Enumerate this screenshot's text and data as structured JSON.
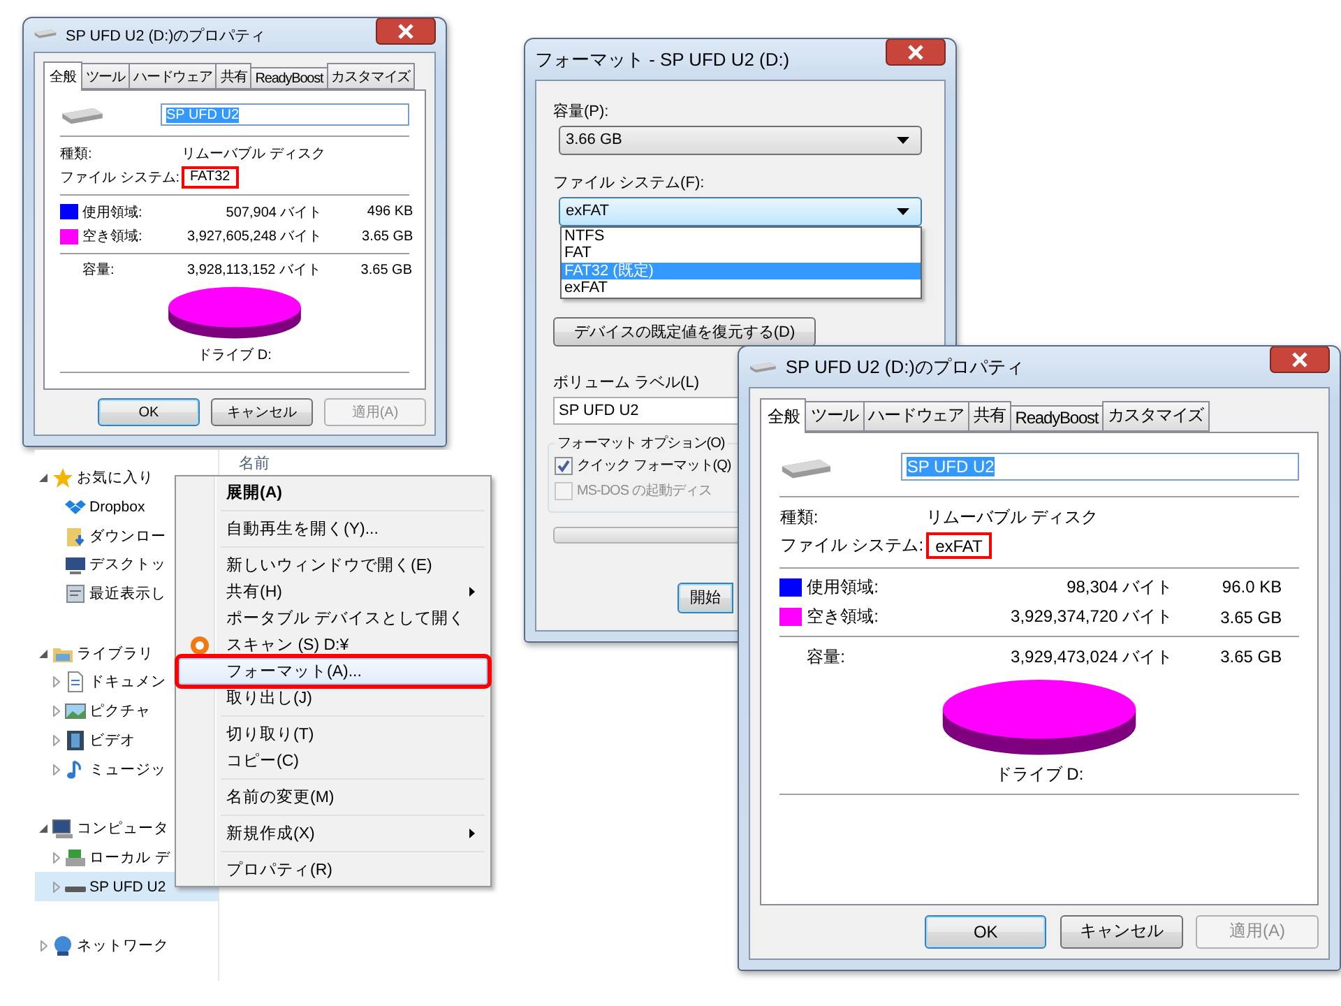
{
  "property_windows": [
    {
      "title": "SP UFD U2 (D:)のプロパティ",
      "tabs": [
        {
          "label": "全般",
          "selected": true
        },
        {
          "label": "ツール",
          "selected": false
        },
        {
          "label": "ハードウェア",
          "selected": false
        },
        {
          "label": "共有",
          "selected": false
        },
        {
          "label": "ReadyBoost",
          "selected": false
        },
        {
          "label": "カスタマイズ",
          "selected": false
        }
      ],
      "name": "SP UFD U2",
      "name_selected": true,
      "type_label": "種類:",
      "type_value": "リムーバブル ディスク",
      "fs_label": "ファイル システム:",
      "fs_value": "FAT32",
      "fs_highlighted": true,
      "usage": [
        {
          "label": "使用領域:",
          "color": "#0000ff",
          "bytes": "507,904 バイト",
          "size": "496 KB"
        },
        {
          "label": "空き領域:",
          "color": "#ff00ff",
          "bytes": "3,927,605,248 バイト",
          "size": "3.65 GB"
        }
      ],
      "capacity": {
        "label": "容量:",
        "bytes": "3,928,113,152 バイト",
        "size": "3.65 GB"
      },
      "drive_label": "ドライブ D:",
      "buttons": [
        {
          "label": "OK",
          "default": true,
          "disabled": false
        },
        {
          "label": "キャンセル",
          "default": false,
          "disabled": false
        },
        {
          "label": "適用(A)",
          "default": false,
          "disabled": true
        }
      ]
    },
    {
      "title": "SP UFD U2 (D:)のプロパティ",
      "tabs": [
        {
          "label": "全般",
          "selected": true
        },
        {
          "label": "ツール",
          "selected": false
        },
        {
          "label": "ハードウェア",
          "selected": false
        },
        {
          "label": "共有",
          "selected": false
        },
        {
          "label": "ReadyBoost",
          "selected": false
        },
        {
          "label": "カスタマイズ",
          "selected": false
        }
      ],
      "name": "SP UFD U2",
      "name_selected": true,
      "type_label": "種類:",
      "type_value": "リムーバブル ディスク",
      "fs_label": "ファイル システム:",
      "fs_value": "exFAT",
      "fs_highlighted": true,
      "usage": [
        {
          "label": "使用領域:",
          "color": "#0000ff",
          "bytes": "98,304 バイト",
          "size": "96.0 KB"
        },
        {
          "label": "空き領域:",
          "color": "#ff00ff",
          "bytes": "3,929,374,720 バイト",
          "size": "3.65 GB"
        }
      ],
      "capacity": {
        "label": "容量:",
        "bytes": "3,929,473,024 バイト",
        "size": "3.65 GB"
      },
      "drive_label": "ドライブ D:",
      "buttons": [
        {
          "label": "OK",
          "default": true,
          "disabled": false
        },
        {
          "label": "キャンセル",
          "default": false,
          "disabled": false
        },
        {
          "label": "適用(A)",
          "default": false,
          "disabled": true
        }
      ]
    }
  ],
  "explorer": {
    "column_header": "名前",
    "tree": [
      {
        "label": "お気に入り",
        "kind": "star",
        "expanded": true,
        "selected": false,
        "children": [
          {
            "label": "Dropbox",
            "kind": "dropbox",
            "selected": false
          },
          {
            "label": "ダウンロー",
            "kind": "download",
            "selected": false
          },
          {
            "label": "デスクトッ",
            "kind": "desktop",
            "selected": false
          },
          {
            "label": "最近表示し",
            "kind": "recent",
            "selected": false
          }
        ]
      },
      {
        "label": "ライブラリ",
        "kind": "library",
        "expanded": true,
        "selected": false,
        "children": [
          {
            "label": "ドキュメン",
            "kind": "document",
            "expanded": false,
            "selected": false
          },
          {
            "label": "ピクチャ",
            "kind": "picture",
            "expanded": false,
            "selected": false
          },
          {
            "label": "ビデオ",
            "kind": "video",
            "expanded": false,
            "selected": false
          },
          {
            "label": "ミュージッ",
            "kind": "music",
            "expanded": false,
            "selected": false
          }
        ]
      },
      {
        "label": "コンピュータ",
        "kind": "computer",
        "expanded": true,
        "selected": false,
        "children": [
          {
            "label": "ローカル デ",
            "kind": "disk",
            "expanded": false,
            "selected": false
          },
          {
            "label": "SP UFD U2",
            "kind": "usb",
            "expanded": false,
            "selected": true
          }
        ]
      },
      {
        "label": "ネットワーク",
        "kind": "network",
        "expanded": false,
        "selected": false
      }
    ]
  },
  "context_menu": [
    {
      "kind": "item",
      "label": "展開(A)",
      "bold": true
    },
    {
      "kind": "separator"
    },
    {
      "kind": "item",
      "label": "自動再生を開く(Y)..."
    },
    {
      "kind": "separator"
    },
    {
      "kind": "item",
      "label": "新しいウィンドウで開く(E)"
    },
    {
      "kind": "item",
      "label": "共有(H)",
      "submenu": true
    },
    {
      "kind": "item",
      "label": "ポータブル デバイスとして開く"
    },
    {
      "kind": "item",
      "label": "スキャン (S) D:¥",
      "icon": true
    },
    {
      "kind": "item",
      "label": "フォーマット(A)...",
      "highlighted": true
    },
    {
      "kind": "item",
      "label": "取り出し(J)"
    },
    {
      "kind": "separator"
    },
    {
      "kind": "item",
      "label": "切り取り(T)"
    },
    {
      "kind": "item",
      "label": "コピー(C)"
    },
    {
      "kind": "separator"
    },
    {
      "kind": "item",
      "label": "名前の変更(M)"
    },
    {
      "kind": "separator"
    },
    {
      "kind": "item",
      "label": "新規作成(X)",
      "submenu": true
    },
    {
      "kind": "separator"
    },
    {
      "kind": "item",
      "label": "プロパティ(R)"
    }
  ],
  "format_dialog": {
    "title": "フォーマット - SP UFD U2 (D:)",
    "capacity_label": "容量(P):",
    "capacity_value": "3.66 GB",
    "fs_label": "ファイル システム(F):",
    "fs_value": "exFAT",
    "fs_options": [
      {
        "label": "NTFS",
        "selected": false
      },
      {
        "label": "FAT",
        "selected": false
      },
      {
        "label": "FAT32 (既定)",
        "selected": true
      },
      {
        "label": "exFAT",
        "selected": false
      }
    ],
    "restore_button": "デバイスの既定値を復元する(D)",
    "volume_label": "ボリューム ラベル(L)",
    "volume_value": "SP UFD U2",
    "options_legend": "フォーマット オプション(O)",
    "options": [
      {
        "label": "クイック フォーマット(Q)",
        "checked": true,
        "disabled": false
      },
      {
        "label": "MS-DOS の起動ディス",
        "checked": false,
        "disabled": true
      }
    ],
    "progress": {
      "level": 0
    },
    "start_button": "開始"
  }
}
